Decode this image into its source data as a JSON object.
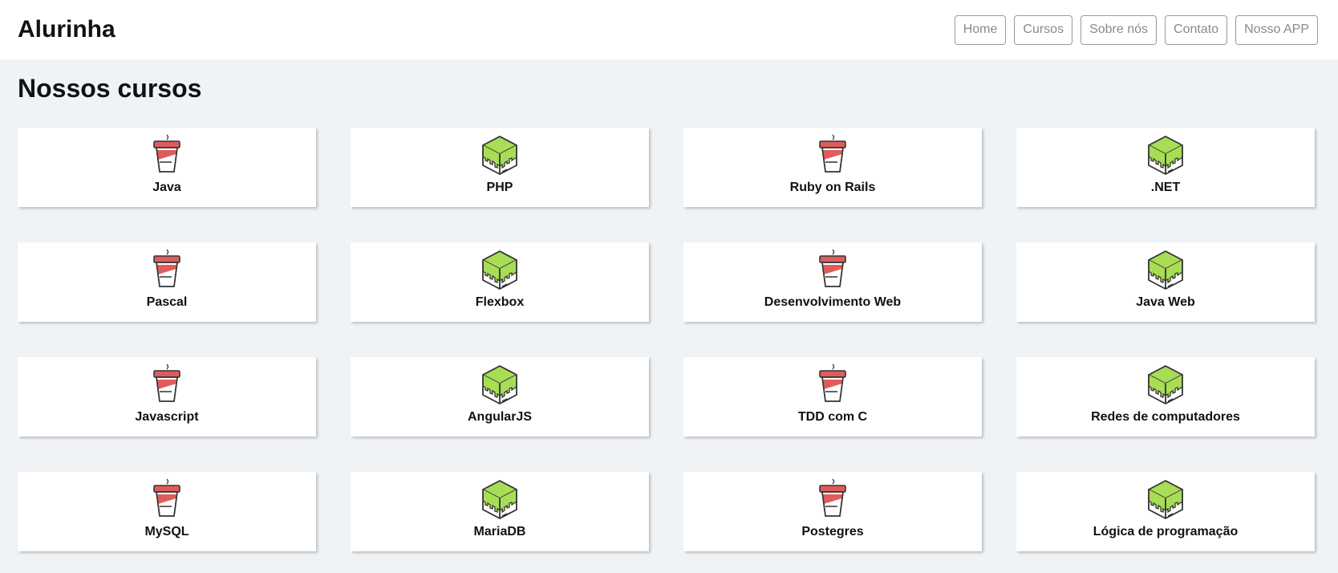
{
  "header": {
    "logo": "Alurinha",
    "nav": [
      {
        "label": "Home",
        "name": "nav-home"
      },
      {
        "label": "Cursos",
        "name": "nav-cursos"
      },
      {
        "label": "Sobre nós",
        "name": "nav-sobre-nos"
      },
      {
        "label": "Contato",
        "name": "nav-contato"
      },
      {
        "label": "Nosso APP",
        "name": "nav-nosso-app"
      }
    ]
  },
  "main": {
    "title": "Nossos cursos",
    "courses": [
      {
        "label": "Java",
        "icon": "coffee-cup-icon"
      },
      {
        "label": "PHP",
        "icon": "green-cube-icon"
      },
      {
        "label": "Ruby on Rails",
        "icon": "coffee-cup-icon"
      },
      {
        "label": ".NET",
        "icon": "green-cube-icon"
      },
      {
        "label": "Pascal",
        "icon": "coffee-cup-icon"
      },
      {
        "label": "Flexbox",
        "icon": "green-cube-icon"
      },
      {
        "label": "Desenvolvimento Web",
        "icon": "coffee-cup-icon"
      },
      {
        "label": "Java Web",
        "icon": "green-cube-icon"
      },
      {
        "label": "Javascript",
        "icon": "coffee-cup-icon"
      },
      {
        "label": "AngularJS",
        "icon": "green-cube-icon"
      },
      {
        "label": "TDD com C",
        "icon": "coffee-cup-icon"
      },
      {
        "label": "Redes de computadores",
        "icon": "green-cube-icon"
      },
      {
        "label": "MySQL",
        "icon": "coffee-cup-icon"
      },
      {
        "label": "MariaDB",
        "icon": "green-cube-icon"
      },
      {
        "label": "Postegres",
        "icon": "coffee-cup-icon"
      },
      {
        "label": "Lógica de programação",
        "icon": "green-cube-icon"
      }
    ]
  },
  "colors": {
    "page_background": "#f0f3f6",
    "cup_red": "#e05c5c",
    "cube_green": "#a8dd55"
  }
}
